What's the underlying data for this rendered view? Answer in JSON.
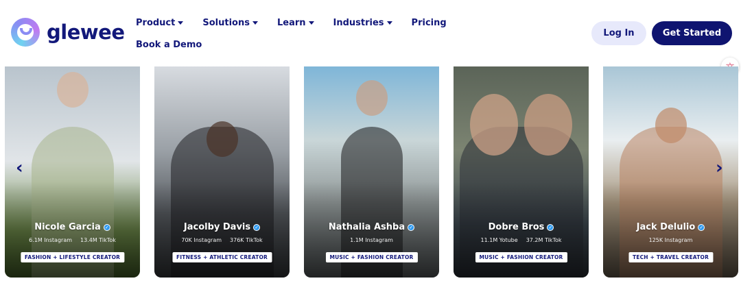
{
  "brand": {
    "name": "glewee"
  },
  "nav": {
    "items": [
      {
        "label": "Product",
        "has_dropdown": true
      },
      {
        "label": "Solutions",
        "has_dropdown": true
      },
      {
        "label": "Learn",
        "has_dropdown": true
      },
      {
        "label": "Industries",
        "has_dropdown": true
      },
      {
        "label": "Pricing",
        "has_dropdown": false
      }
    ],
    "book_demo": "Book a Demo"
  },
  "actions": {
    "login": "Log In",
    "get_started": "Get Started"
  },
  "carousel": {
    "prev_icon": "chevron-left-icon",
    "next_icon": "chevron-right-icon",
    "cards": [
      {
        "name": "Nicole Garcia",
        "stats": [
          "6.1M Instagram",
          "13.4M TikTok"
        ],
        "tag": "FASHION + LIFESTYLE CREATOR"
      },
      {
        "name": "Jacolby Davis",
        "stats": [
          "70K Instagram",
          "376K TikTok"
        ],
        "tag": "FITNESS + ATHLETIC CREATOR"
      },
      {
        "name": "Nathalia Ashba",
        "stats": [
          "1.1M Instagram"
        ],
        "tag": "MUSIC + FASHION CREATOR"
      },
      {
        "name": "Dobre Bros",
        "stats": [
          "11.1M Yotube",
          "37.2M TikTok"
        ],
        "tag": "MUSIC + FASHION CREATOR"
      },
      {
        "name": "Jack Delulio",
        "stats": [
          "125K Instagram"
        ],
        "tag": "TECH + TRAVEL CREATOR"
      }
    ]
  },
  "colors": {
    "brand_navy": "#12187a",
    "button_navy": "#0f1470",
    "login_bg": "#e7e9fb",
    "verified_blue": "#2f9af0"
  }
}
